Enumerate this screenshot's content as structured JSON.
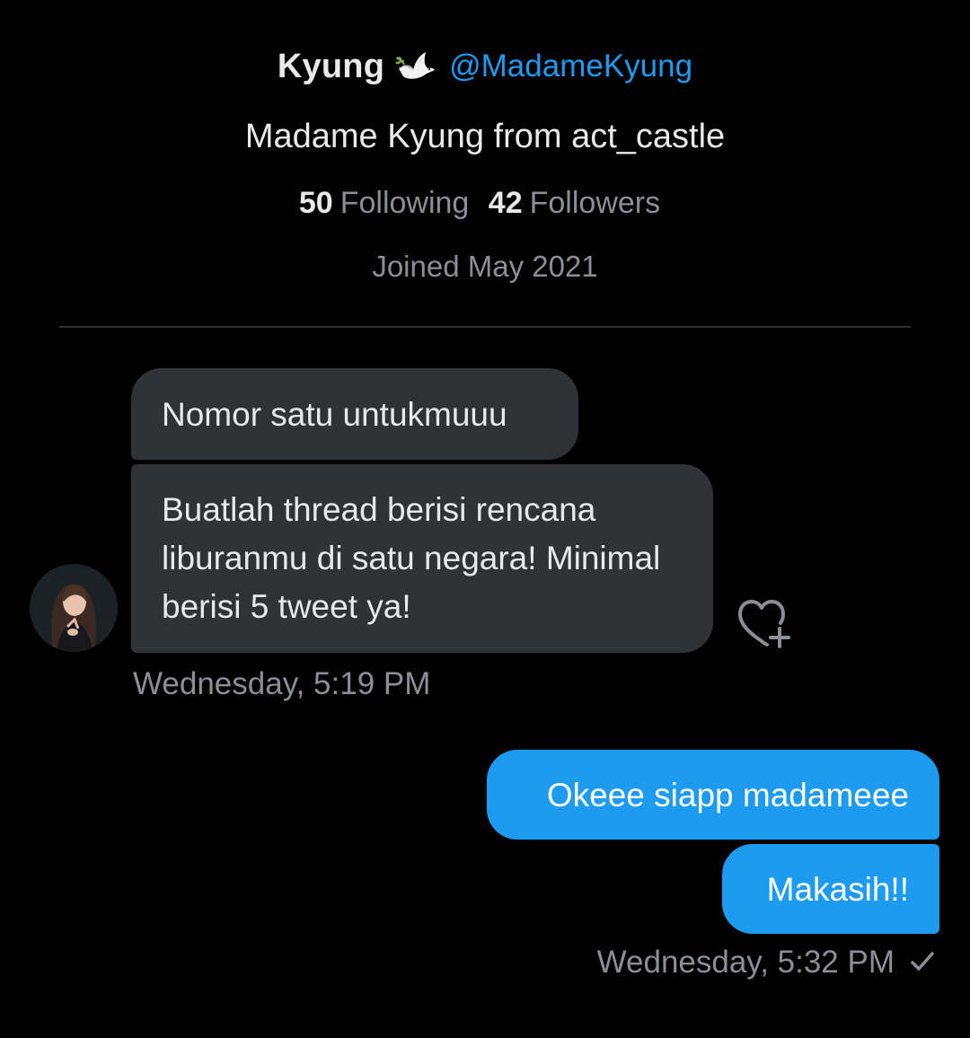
{
  "profile": {
    "display_name": "Kyung",
    "emoji_icon": "dove-icon",
    "handle": "@MadameKyung",
    "bio": "Madame Kyung from act_castle",
    "following_count": "50",
    "following_label": "Following",
    "followers_count": "42",
    "followers_label": "Followers",
    "joined": "Joined May 2021"
  },
  "messages": {
    "received": [
      {
        "text": "Nomor satu untukmuuu"
      },
      {
        "text": "Buatlah thread berisi rencana liburanmu di satu negara! Minimal berisi 5 tweet ya!"
      }
    ],
    "received_timestamp": "Wednesday, 5:19 PM",
    "sent": [
      {
        "text": "Okeee siapp madameee"
      },
      {
        "text": "Makasih!!"
      }
    ],
    "sent_timestamp": "Wednesday, 5:32 PM"
  },
  "icons": {
    "avatar": "avatar",
    "reaction": "heart-add-icon",
    "read_status": "check-icon"
  },
  "colors": {
    "background": "#000000",
    "accent": "#1d9bf0",
    "received_bubble": "#2f3336",
    "secondary_text": "#8b8f94"
  }
}
